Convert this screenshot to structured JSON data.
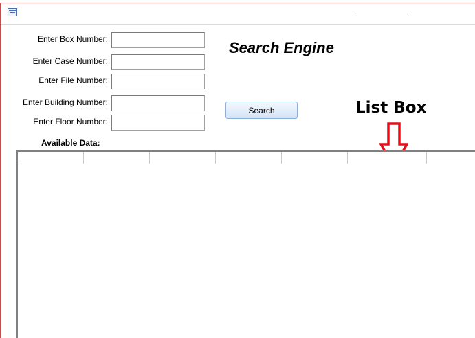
{
  "form": {
    "fields": [
      {
        "label": "Enter Box Number:",
        "value": ""
      },
      {
        "label": "Enter Case Number:",
        "value": ""
      },
      {
        "label": "Enter File Number:",
        "value": ""
      },
      {
        "label": "Enter Building Number:",
        "value": ""
      },
      {
        "label": "Enter Floor Number:",
        "value": ""
      }
    ],
    "heading": "Search Engine",
    "search_button": "Search",
    "available_label": "Available Data:"
  },
  "annotation": {
    "caption": "List Box",
    "arrow_color": "#e3101b"
  },
  "listbox": {
    "column_count": 7,
    "rows": []
  },
  "colors": {
    "frame": "#c0504d",
    "button_border": "#8eb0d8"
  }
}
